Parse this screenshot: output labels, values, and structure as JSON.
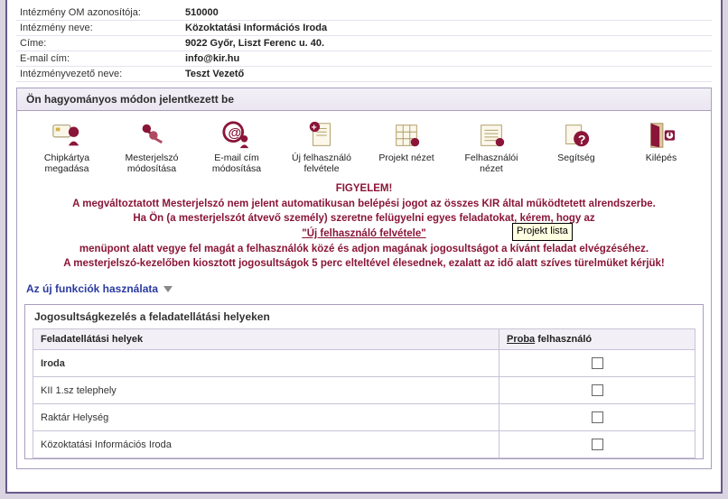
{
  "info": {
    "om_label": "Intézmény OM azonosítója:",
    "om_value": "510000",
    "name_label": "Intézmény neve:",
    "name_value": "Közoktatási Információs Iroda",
    "addr_label": "Címe:",
    "addr_value": "9022 Győr, Liszt Ferenc u. 40.",
    "email_label": "E-mail cím:",
    "email_value": "info@kir.hu",
    "leader_label": "Intézményvezető neve:",
    "leader_value": "Teszt Vezető"
  },
  "login_bar": "Ön hagyományos módon jelentkezett be",
  "toolbar": {
    "chipcard": "Chipkártya megadása",
    "masterpw": "Mesterjelszó módosítása",
    "email": "E-mail cím módosítása",
    "newuser": "Új felhasználó felvétele",
    "project": "Projekt nézet",
    "userview": "Felhasználói nézet",
    "help": "Segítség",
    "logout": "Kilépés"
  },
  "tooltip": "Projekt lista",
  "notice": {
    "l0": "FIGYELEM!",
    "l1": "A megváltoztatott Mesterjelszó nem jelent automatikusan belépési jogot az összes KIR által működtetett alrendszerbe.",
    "l2a": "Ha Ön (a mesterjelszót átvevő személy) szeretne felügyelni egyes feladatokat, kérem, hogy az",
    "l2b": "\"Új felhasználó felvétele\"",
    "l3": "menüpont alatt vegye fel magát a felhasználók közé és adjon magának jogosultságot a kívánt feladat elvégzéséhez.",
    "l4": "A mesterjelszó-kezelőben kiosztott jogosultságok 5 perc elteltével élesednek, ezalatt az idő alatt szíves türelmüket kérjük!"
  },
  "expander_label": "Az új funkciók használata",
  "perm": {
    "title": "Jogosultságkezelés a feladatellátási helyeken",
    "col1": "Feladatellátási helyek",
    "col2_link": "Proba",
    "col2_rest": " felhasználó",
    "rows": [
      {
        "name": "Iroda",
        "bold": true
      },
      {
        "name": "KII 1.sz telephely",
        "bold": false
      },
      {
        "name": "Raktár Helység",
        "bold": false
      },
      {
        "name": "Közoktatási Információs Iroda",
        "bold": false
      }
    ]
  }
}
